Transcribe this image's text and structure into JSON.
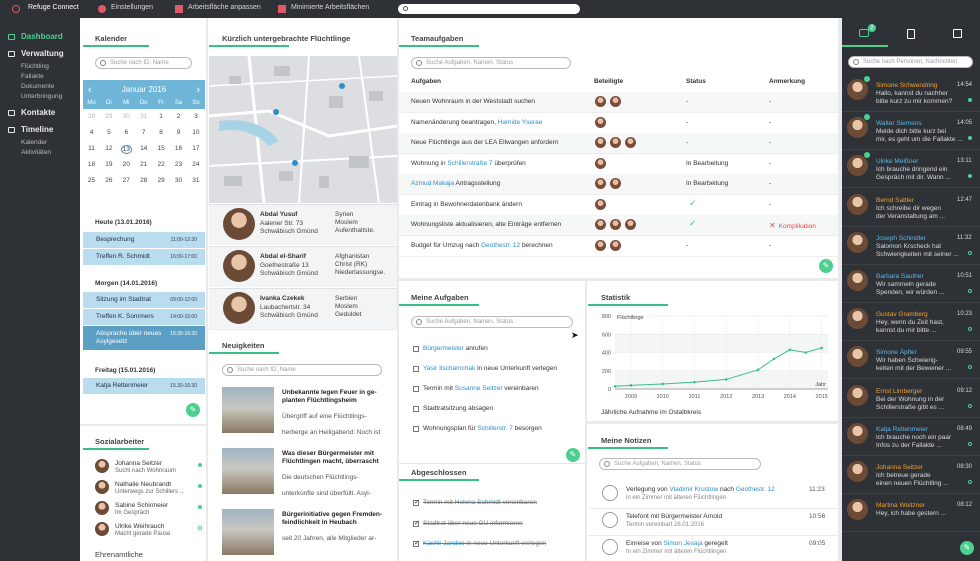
{
  "app": {
    "title": "Refuge Connect",
    "menu": [
      "Einstellungen",
      "Arbeitsfläche anpassen",
      "Minimierte Arbeitsflächen"
    ]
  },
  "sidebar": {
    "sections": [
      {
        "label": "Dashboard",
        "active": true,
        "items": []
      },
      {
        "label": "Verwaltung",
        "active": false,
        "items": [
          "Flüchtling",
          "Fallakte",
          "Dokumente",
          "Unterbringung"
        ]
      },
      {
        "label": "Kontakte",
        "active": false,
        "items": []
      },
      {
        "label": "Timeline",
        "active": false,
        "items": [
          "Kalender",
          "Aktivitäten"
        ]
      }
    ]
  },
  "kalender": {
    "title": "Kalender",
    "search_placeholder": "Suche nach ID, Name",
    "month": "Januar 2016",
    "weekdays": [
      "Mo",
      "Di",
      "Mi",
      "Do",
      "Fr",
      "Sa",
      "So"
    ],
    "rows": [
      [
        "28",
        "29",
        "30",
        "31",
        "1",
        "2",
        "3"
      ],
      [
        "4",
        "5",
        "6",
        "7",
        "8",
        "9",
        "10"
      ],
      [
        "11",
        "12",
        "13",
        "14",
        "15",
        "16",
        "17"
      ],
      [
        "18",
        "19",
        "20",
        "21",
        "22",
        "23",
        "24"
      ],
      [
        "25",
        "26",
        "27",
        "28",
        "29",
        "30",
        "31"
      ]
    ],
    "today": "13",
    "groups": [
      {
        "heading": "Heute (13.01.2016)",
        "events": [
          {
            "title": "Besprechung",
            "time": "11:00-12:30"
          },
          {
            "title": "Treffen R. Schmidt",
            "time": "16:00-17:00"
          }
        ]
      },
      {
        "heading": "Morgen (14.01.2016)",
        "events": [
          {
            "title": "Sitzung im Stadtrat",
            "time": "09:00-12:00"
          },
          {
            "title": "Treffen K. Sommers",
            "time": "14:00-15:00"
          },
          {
            "title": "Absprache über neues Asylgesetz",
            "time": "15:30-16:30"
          }
        ]
      },
      {
        "heading": "Freitag (15.01.2016)",
        "events": [
          {
            "title": "Katja Rettenmeier",
            "time": "15.30-16:30"
          }
        ]
      }
    ]
  },
  "sozial": {
    "title": "Sozialarbeiter",
    "people": [
      {
        "name": "Johanna Seitzer",
        "status": "Sucht nach Wohnraum"
      },
      {
        "name": "Nathalie Neubrandt",
        "status": "Unterwegs zur Schillers ..."
      },
      {
        "name": "Sabine Schirmeier",
        "status": "Im Gespräch"
      },
      {
        "name": "Ulrike Weihrauch",
        "status": "Macht gerade Pause"
      }
    ],
    "next_heading": "Ehrenamtliche"
  },
  "refugees": {
    "title": "Kürzlich untergebrachte Flüchtlinge",
    "people": [
      {
        "name": "Abdal Yusuf",
        "address": "Aalener Str. 73\nSchwäbisch Gmünd",
        "origin": "Syrien\nMoslem\nAufenthaltste."
      },
      {
        "name": "Abdal el-Sharif",
        "address": "Goethestraße 13\nSchwäbisch Gmünd",
        "origin": "Afghanistan\nChrist (RK)\nNiederlassungse."
      },
      {
        "name": "Ivanka Czekek",
        "address": "Laubachertstr. 34\nSchwäbisch Gmünd",
        "origin": "Serbien\nMoslem\nGeduldet"
      }
    ]
  },
  "news": {
    "title": "Neuigkeiten",
    "search_placeholder": "Suche nach ID, Name",
    "items": [
      {
        "headline": "Unbekannte legen Feuer in ge-\nplanten Flüchtlingsheim",
        "body": "Übergriff auf eine Flüchtlings-\nherberge an Heiligabend: Noch ist"
      },
      {
        "headline": "Was dieser Bürgermeister mit\nFlüchtlingen macht, überrascht",
        "body": "Die deutschen Flüchtlings-\nunterkünfte sind überfüllt. Asyl-"
      },
      {
        "headline": "Bürgerinitiative gegen Fremden-\nfeindlichkeit in Heubach",
        "body": "seit 20 Jahren, alle Mitglieder ar-"
      }
    ]
  },
  "team": {
    "title": "Teamaufgaben",
    "search_placeholder": "Suche Aufgaben, Namen, Status",
    "columns": [
      "Aufgaben",
      "Beteiligte",
      "Status",
      "Anmerkung"
    ],
    "rows": [
      {
        "pre": "Neuen Wohnraum in der Weststadt suchen",
        "link": "",
        "post": "",
        "count": 2,
        "status": "-",
        "note": "-"
      },
      {
        "pre": "Namenänderung beantragen, ",
        "link": "Hamide Yserae",
        "post": "",
        "count": 1,
        "status": "-",
        "note": "-"
      },
      {
        "pre": "Neue Flüchtlinge aus der LEA Ellwangen anfordern",
        "link": "",
        "post": "",
        "count": 3,
        "status": "-",
        "note": "-"
      },
      {
        "pre": "Wohnung in ",
        "link": "Schillerstraße 7",
        "post": " überprüfen",
        "count": 1,
        "status": "In Bearbeitung",
        "note": "-"
      },
      {
        "pre": "",
        "link": "Azmud Makaja",
        "post": " Antragsstellung",
        "count": 2,
        "status": "In Bearbeitung",
        "note": "-"
      },
      {
        "pre": "Eintrag in Bewohnerdatenbank ändern",
        "link": "",
        "post": "",
        "count": 1,
        "status": "✓",
        "note": "-"
      },
      {
        "pre": "Wohnungsliste aktualisieren, alte Einträge entfernen",
        "link": "",
        "post": "",
        "count": 3,
        "status": "✓",
        "note": "Komplikation"
      },
      {
        "pre": "Budget für Umzug nach ",
        "link": "Geothestr. 12",
        "post": " berechnen",
        "count": 2,
        "status": "-",
        "note": "-"
      }
    ]
  },
  "my_tasks": {
    "title": "Meine Aufgaben",
    "search_placeholder": "Suche Aufgaben, Namen, Status",
    "items": [
      {
        "pre": "",
        "link": "Bürgermeister",
        "post": " anrufen"
      },
      {
        "pre": "",
        "link": "Yasir Ilschamchak",
        "post": " in neue Unterkunft verlegen"
      },
      {
        "pre": "Termin mit ",
        "link": "Susanne Seitzer",
        "post": " vereinbaren"
      },
      {
        "pre": "Stadtratsitzung absagen",
        "link": "",
        "post": ""
      },
      {
        "pre": "Wohnungsplan für ",
        "link": "Schillerstr. 7",
        "post": " besorgen"
      }
    ],
    "done_title": "Abgeschlossen",
    "done": [
      {
        "pre": "Termin mit ",
        "link": "Helena Schmidt",
        "post": " vereinbaren"
      },
      {
        "pre": "Stadtrat über neue GU informieren",
        "link": "",
        "post": ""
      },
      {
        "pre": "",
        "link": "Kashir Jandoo",
        "post": " in neue Unterkunft verlegen"
      }
    ]
  },
  "stats": {
    "title": "Statistik",
    "caption": "Jährliche Aufnahme im Ostalbkreis"
  },
  "chart_data": {
    "type": "line",
    "title": "",
    "ylabel": "Flüchtlinge",
    "xlabel": "Jahr",
    "ylim": [
      0,
      800
    ],
    "yticks": [
      0,
      200,
      400,
      600,
      800
    ],
    "categories": [
      "2009",
      "2010",
      "2011",
      "2012",
      "2013",
      "2014",
      "2015"
    ],
    "x": [
      2008.5,
      2009,
      2010,
      2011,
      2012,
      2013,
      2013.5,
      2014,
      2014.5,
      2015
    ],
    "values": [
      30,
      40,
      55,
      75,
      105,
      210,
      330,
      430,
      400,
      450
    ],
    "grid": true
  },
  "notes": {
    "title": "Meine Notizen",
    "search_placeholder": "Suche Aufgaben, Namen, Status",
    "items": [
      {
        "text1": "Verlegung von ",
        "link1": "Vladimir Krustow",
        "text2": " nach ",
        "link2": "Geothestr. 12",
        "line2": "in ein Zimmer mit älteren Flüchtlingen",
        "time": "11:23"
      },
      {
        "text1": "Telefont mit Bürgermeister Arnold",
        "link1": "",
        "text2": "",
        "link2": "",
        "line2": "Termin vereinbart 28.01.2016",
        "time": "10:56"
      },
      {
        "text1": "Einreise von ",
        "link1": "Simon Jesaja",
        "text2": " geregelt",
        "link2": "",
        "line2": "In ein Zimmer mit älteren Flüchtlingen",
        "time": "09:05"
      }
    ]
  },
  "chat": {
    "badge": "2",
    "search_placeholder": "Suche nach Personen, Nachrichten",
    "items": [
      {
        "name": "Simone Schwendring",
        "msg": "Hallo, kannst du nachher\nbitte kurz zu mir kommen?",
        "time": "14:54",
        "color": "#f0a030",
        "dot": "filled"
      },
      {
        "name": "Walter Siemens",
        "msg": "Melde dich bitte kurz bei\nmir, es geht um die Fallakte ...",
        "time": "14:05",
        "color": "#5ab8e8",
        "dot": "filled"
      },
      {
        "name": "Ulrike Meißner",
        "msg": "Ich brauche dringend ein\nGespräch mit dir. Wann ...",
        "time": "13:11",
        "color": "#5ab8e8",
        "dot": "filled"
      },
      {
        "name": "Bernd Sattler",
        "msg": "Ich schreibe dir wegen\nder Veranstaltung am ...",
        "time": "12:47",
        "color": "#f0a030",
        "dot": "none"
      },
      {
        "name": "Joseph Schindler",
        "msg": "Salomon Krscheck hat\nSchwierigkeiten mit seiner ...",
        "time": "11:32",
        "color": "#5ab8e8",
        "dot": "open"
      },
      {
        "name": "Barbara Sauther",
        "msg": "Wir sammeln gerade\nSpenden, wir würden ...",
        "time": "10:51",
        "color": "#5ab8e8",
        "dot": "open"
      },
      {
        "name": "Gustav Gramberg",
        "msg": "Hey, wenn du Zeit hast,\nkannst du mir bitte ...",
        "time": "10:23",
        "color": "#f0a030",
        "dot": "open"
      },
      {
        "name": "Simone Äpfler",
        "msg": "Wir haben Schwierig-\nkeiten mit der Beweiner ...",
        "time": "09:55",
        "color": "#5ab8e8",
        "dot": "open"
      },
      {
        "name": "Ernst Limberger",
        "msg": "Bei der Wohnung in der\nSchillerstraße gibt es ...",
        "time": "09:12",
        "color": "#f0a030",
        "dot": "open"
      },
      {
        "name": "Katja Rettenmeier",
        "msg": "Ich brauche noch ein paar\nInfos zu der Fallakte ...",
        "time": "08:49",
        "color": "#5ab8e8",
        "dot": "open"
      },
      {
        "name": "Johanna Seitzer",
        "msg": "Ich betreue gerade\neinen neuen Flüchtling ...",
        "time": "08:30",
        "color": "#f0a030",
        "dot": "open"
      },
      {
        "name": "Martina Weitzner",
        "msg": "Hey, ich habe gestern ...",
        "time": "08:12",
        "color": "#f0a030",
        "dot": "none"
      }
    ]
  },
  "colors": {
    "accent": "#3cbf87",
    "link": "#2d8fc9",
    "calendar": "#6fb5d7",
    "dark": "#2e3135",
    "danger": "#d9534f"
  }
}
